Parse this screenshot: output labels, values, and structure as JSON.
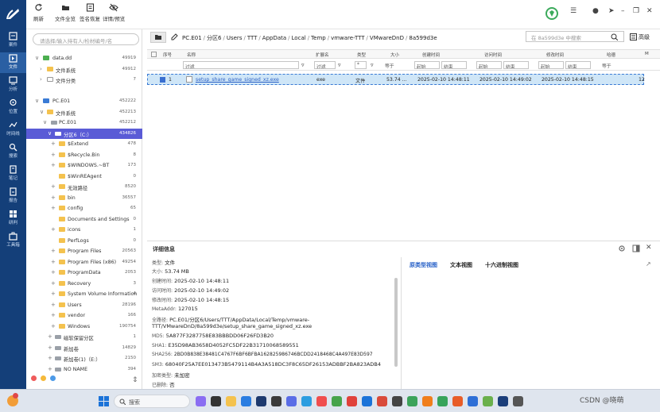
{
  "nav": {
    "items": [
      {
        "label": "案件"
      },
      {
        "label": "文件"
      },
      {
        "label": "分析"
      },
      {
        "label": "位置"
      },
      {
        "label": "时间线"
      },
      {
        "label": "搜索"
      },
      {
        "label": "笔记"
      },
      {
        "label": "报告"
      },
      {
        "label": "研判"
      },
      {
        "label": "工具箱"
      }
    ]
  },
  "toolbar": {
    "refresh": "刷新",
    "file_overview": "文件全览",
    "sig_recover": "签名恢复",
    "details_preview": "详情/预览"
  },
  "search": {
    "placeholder": "请选择/输入持有人/检材编号/名"
  },
  "tree": [
    {
      "label": "data.dd",
      "count": "49919"
    },
    {
      "label": "文件系统",
      "count": "49912"
    },
    {
      "label": "文件分类",
      "count": "7"
    },
    {
      "label": "PC.E01",
      "count": "452222"
    },
    {
      "label": "文件系统",
      "count": "452213"
    },
    {
      "label": "PC.E01",
      "count": "452212"
    },
    {
      "label": "分区6（C:）",
      "count": "434826"
    },
    {
      "label": "$Extend",
      "count": "478"
    },
    {
      "label": "$Recycle.Bin",
      "count": "8"
    },
    {
      "label": "$WINDOWS.~BT",
      "count": "173"
    },
    {
      "label": "$WinREAgent",
      "count": "0"
    },
    {
      "label": "无效路径",
      "count": "8520"
    },
    {
      "label": "bin",
      "count": "36557"
    },
    {
      "label": "config",
      "count": "65"
    },
    {
      "label": "Documents and Settings",
      "count": "0"
    },
    {
      "label": "icons",
      "count": "1"
    },
    {
      "label": "PerfLogs",
      "count": "0"
    },
    {
      "label": "Program Files",
      "count": "20563"
    },
    {
      "label": "Program Files (x86)",
      "count": "49254"
    },
    {
      "label": "ProgramData",
      "count": "2053"
    },
    {
      "label": "Recovery",
      "count": "3"
    },
    {
      "label": "System Volume Information",
      "count": "4"
    },
    {
      "label": "Users",
      "count": "28196"
    },
    {
      "label": "vendor",
      "count": "166"
    },
    {
      "label": "Windows",
      "count": "190754"
    },
    {
      "label": "磁软保留分区",
      "count": "1"
    },
    {
      "label": "新加卷",
      "count": "14829"
    },
    {
      "label": "新加卷(1)（E:）",
      "count": "2150"
    },
    {
      "label": "NO NAME",
      "count": "394"
    }
  ],
  "path": {
    "segments": [
      "PC.E01",
      "分区6",
      "Users",
      "TTT",
      "AppData",
      "Local",
      "Temp",
      "vmware-TTT",
      "VMwareDnD",
      "8a599d3e"
    ],
    "search_placeholder": "在 8a599d3e 中搜索",
    "advanced": "高级"
  },
  "table": {
    "headers": [
      "序号",
      "名称",
      "扩展名",
      "类型",
      "大小",
      "创建时间",
      "访问时间",
      "修改时间",
      "哈德",
      "M"
    ],
    "filter": {
      "name": "过滤",
      "ext": "过滤",
      "type": "*",
      "size_op": "等于",
      "start": "起始",
      "end": "结束",
      "hash": "等于"
    },
    "rows": [
      {
        "idx": "1",
        "name": "setup_share_game_signed_xz.exe",
        "ext": "exe",
        "type": "文件",
        "size": "53.74 ...",
        "created": "2025-02-10 14:48:11",
        "accessed": "2025-02-10 14:49:02",
        "modified": "2025-02-10 14:48:15",
        "last": "12"
      }
    ]
  },
  "detail": {
    "title": "详细信息",
    "lines": [
      {
        "k": "类型:",
        "v": "文件"
      },
      {
        "k": "大小:",
        "v": "53.74 MB"
      },
      {
        "k": "创建时间:",
        "v": "2025-02-10 14:48:11"
      },
      {
        "k": "访问时间:",
        "v": "2025-02-10 14:49:02"
      },
      {
        "k": "修改时间:",
        "v": "2025-02-10 14:48:15"
      },
      {
        "k": "MetaAddr:",
        "v": "127015"
      },
      {
        "k": "全路径:",
        "v": "PC.E01/分区6/Users/TTT/AppData/Local/Temp/vmware-"
      },
      {
        "k": "",
        "v": "TTT/VMwareDnD/8a599d3e/setup_share_game_signed_xz.exe"
      },
      {
        "k": "MD5:",
        "v": "5A877F3287758E83BBBDD06F26FD3B20"
      },
      {
        "k": "SHA1:",
        "v": "E35D98AB3658D4052FC5DF22B31710068589551"
      },
      {
        "k": "SHA256:",
        "v": "2BD0B838E38481C4767F6BF6BFBA162825986746BCDD2418468C4A497E83D597"
      },
      {
        "k": "SM3:",
        "v": "68040F25A7EE013473B5479114B4A3A518DC3F8C65DF26153ADBBF2BA823ADB4"
      },
      {
        "k": "加密类型:",
        "v": "未加密"
      },
      {
        "k": "已删除:",
        "v": "否"
      }
    ],
    "tabs": [
      "原类型视图",
      "文本视图",
      "十六进制视图"
    ]
  },
  "taskbar": {
    "search": "搜索",
    "tray": "CSDN @晓萌"
  },
  "colors": {
    "nav_bg": "#143f79",
    "selection": "#5a5bd6",
    "row_highlight": "#cfe6f7",
    "accent": "#2861c8"
  }
}
